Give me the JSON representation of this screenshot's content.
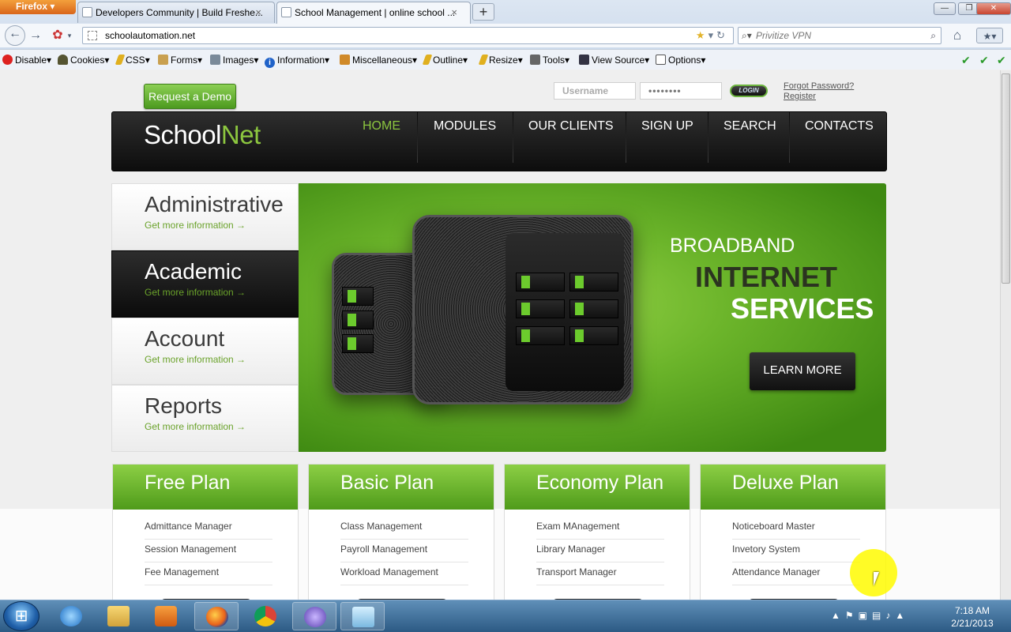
{
  "browser": {
    "app_button": "Firefox",
    "tabs": [
      {
        "label": "Developers Community | Build Freshe..."
      },
      {
        "label": "School Management | online school ..."
      }
    ],
    "url": "schoolautomation.net",
    "search_placeholder": "Privitize VPN",
    "toolbar": [
      {
        "label": "Disable",
        "icon": "no-entry-icon"
      },
      {
        "label": "Cookies",
        "icon": "person-icon"
      },
      {
        "label": "CSS",
        "icon": "pencil-icon"
      },
      {
        "label": "Forms",
        "icon": "clipboard-icon"
      },
      {
        "label": "Images",
        "icon": "image-icon"
      },
      {
        "label": "Information",
        "icon": "info-icon"
      },
      {
        "label": "Miscellaneous",
        "icon": "box-icon"
      },
      {
        "label": "Outline",
        "icon": "pencil-icon"
      },
      {
        "label": "Resize",
        "icon": "pencil-icon"
      },
      {
        "label": "Tools",
        "icon": "wrench-icon"
      },
      {
        "label": "View Source",
        "icon": "monitor-icon"
      },
      {
        "label": "Options",
        "icon": "document-icon"
      }
    ]
  },
  "site": {
    "request_demo": "Request a Demo",
    "username_placeholder": "Username",
    "password_value": "••••••••",
    "login_label": "LOGIN",
    "forgot_password": "Forgot Password?",
    "register": "Register",
    "logo_main": "School",
    "logo_accent": "Net",
    "nav": [
      "HOME",
      "MODULES",
      "OUR CLIENTS",
      "SIGN UP",
      "SEARCH",
      "CONTACTS"
    ],
    "active_nav": "HOME",
    "side_items": [
      {
        "title": "Administrative",
        "more": "Get more information  →"
      },
      {
        "title": "Academic",
        "more": "Get more information  →"
      },
      {
        "title": "Account",
        "more": "Get more information  →"
      },
      {
        "title": "Reports",
        "more": "Get more information  →"
      }
    ],
    "banner": {
      "line1": "BROADBAND",
      "line2": "INTERNET",
      "line3": "SERVICES",
      "button": "LEARN MORE"
    },
    "plans": [
      {
        "name": "Free Plan",
        "items": [
          "Admittance Manager",
          "Session Management",
          "Fee Management"
        ]
      },
      {
        "name": "Basic Plan",
        "items": [
          "Class Management",
          "Payroll Management",
          "Workload Management"
        ]
      },
      {
        "name": "Economy Plan",
        "items": [
          "Exam MAnagement",
          "Library Manager",
          "Transport Manager"
        ]
      },
      {
        "name": "Deluxe Plan",
        "items": [
          "Noticeboard Master",
          "Invetory System",
          "Attendance Manager"
        ]
      }
    ]
  },
  "taskbar": {
    "time": "7:18 AM",
    "date": "2/21/2013"
  },
  "colors": {
    "brand_green": "#8cc63f",
    "dark": "#111111"
  }
}
